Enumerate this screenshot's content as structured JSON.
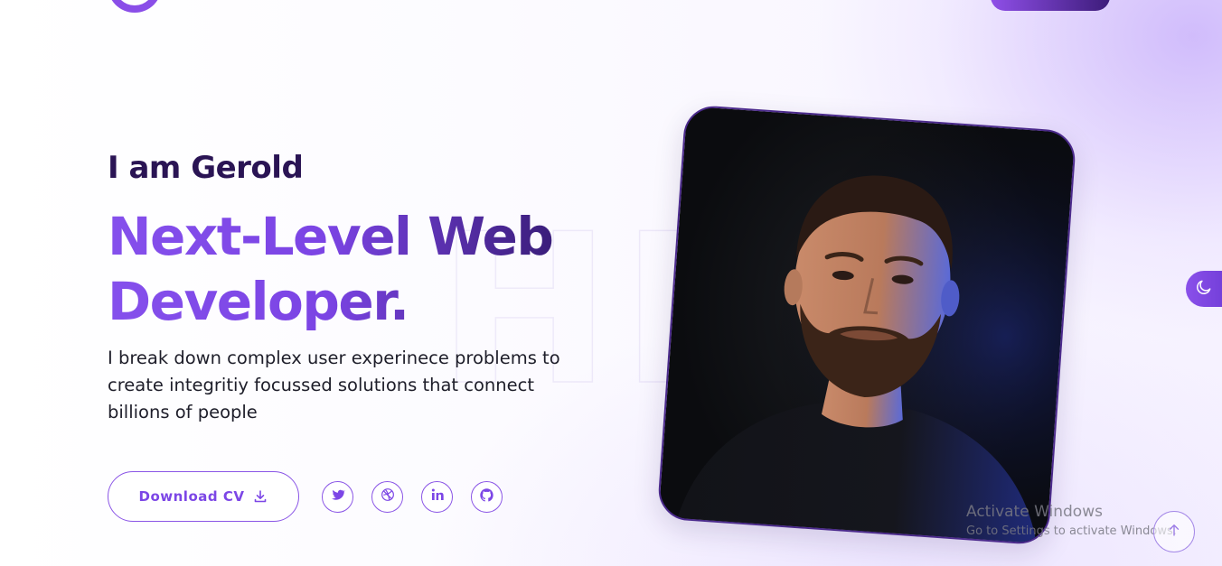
{
  "hero": {
    "intro": "I am Gerold",
    "headline": "Next-Level Web Developer.",
    "description": "I break down complex user experinece problems to create integritiy focussed solutions that connect billions of people",
    "download_label": "Download CV"
  },
  "socials": [
    {
      "name": "twitter",
      "icon": "twitter-icon"
    },
    {
      "name": "dribbble",
      "icon": "dribbble-icon"
    },
    {
      "name": "linkedin",
      "icon": "linkedin-icon"
    },
    {
      "name": "github",
      "icon": "github-icon"
    }
  ],
  "background_word": "HI",
  "os_watermark": {
    "title": "Activate Windows",
    "subtitle": "Go to Settings to activate Windows."
  },
  "colors": {
    "accent": "#8a55e6",
    "accent_dark": "#2e1666",
    "intro_text": "#2a1454",
    "body_text": "#1e1e2a"
  },
  "icons": {
    "theme_toggle": "moon-icon",
    "scroll_top": "arrow-up-icon",
    "download": "download-icon"
  }
}
